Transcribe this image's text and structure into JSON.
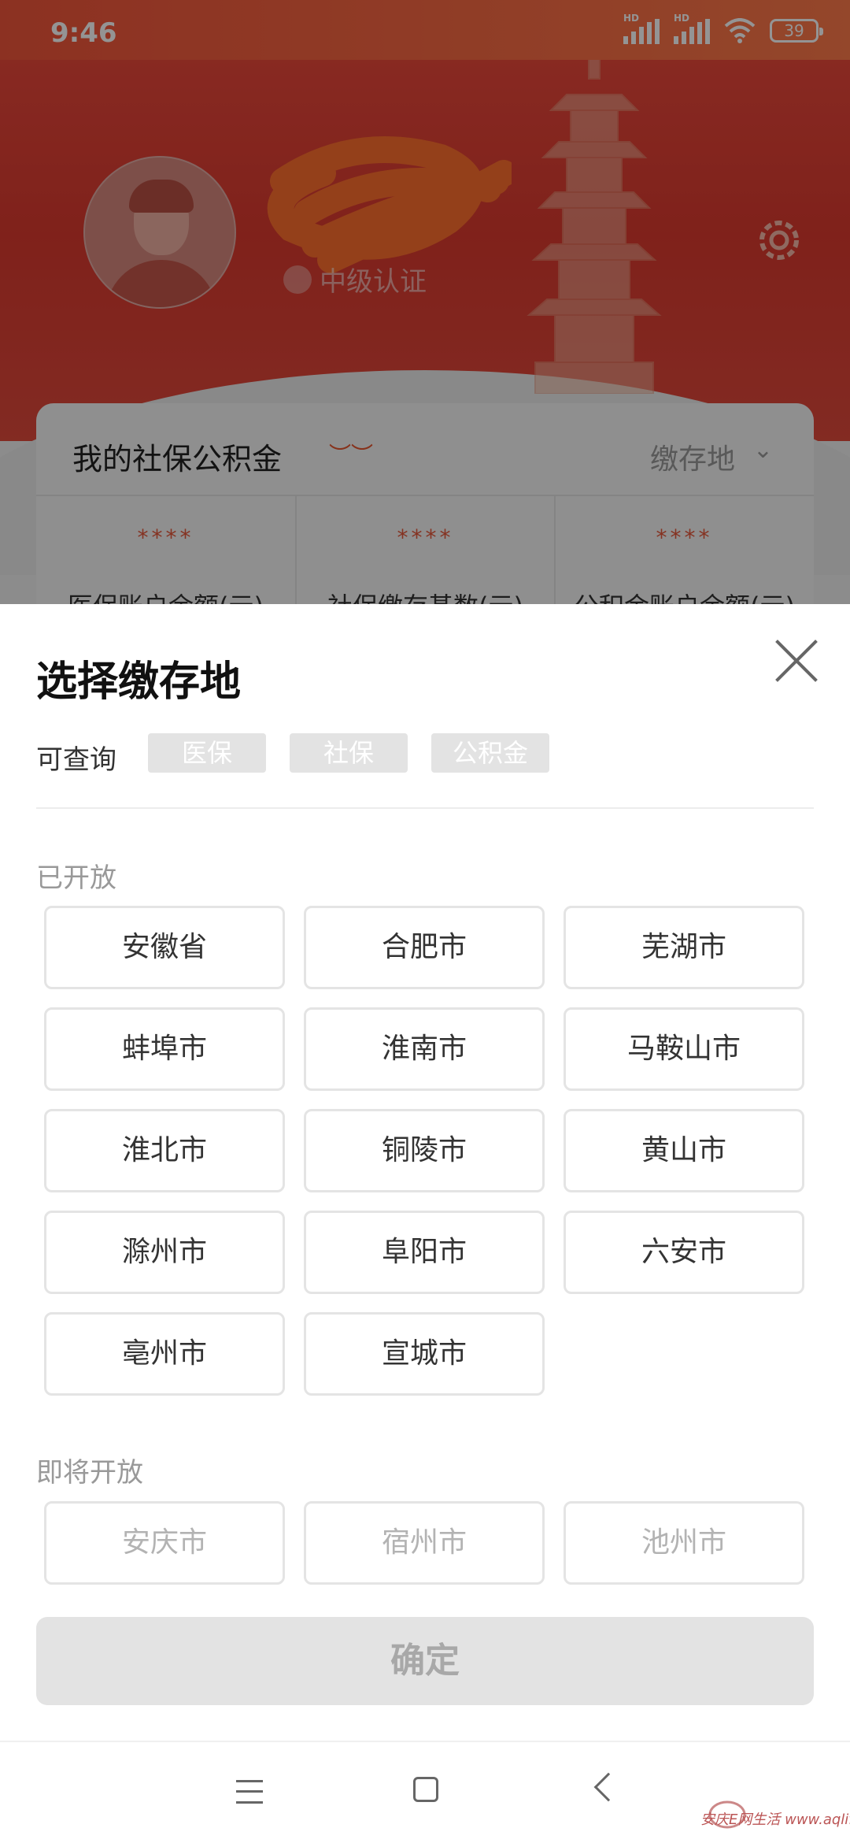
{
  "status_bar": {
    "time": "9:46",
    "battery": "39",
    "hd1": "HD",
    "hd2": "HD"
  },
  "profile": {
    "auth_label": "中级认证",
    "card_title": "我的社保公积金",
    "location_label": "缴存地",
    "stats": [
      {
        "value": "****",
        "label": "医保账户余额(元)"
      },
      {
        "value": "****",
        "label": "社保缴存基数(元)"
      },
      {
        "value": "****",
        "label": "公积金账户余额(元)"
      }
    ]
  },
  "sheet": {
    "title": "选择缴存地",
    "query_label": "可查询",
    "tags": [
      "医保",
      "社保",
      "公积金"
    ],
    "open_section": "已开放",
    "open_cities": [
      "安徽省",
      "合肥市",
      "芜湖市",
      "蚌埠市",
      "淮南市",
      "马鞍山市",
      "淮北市",
      "铜陵市",
      "黄山市",
      "滁州市",
      "阜阳市",
      "六安市",
      "亳州市",
      "宣城市"
    ],
    "soon_section": "即将开放",
    "soon_cities": [
      "安庆市",
      "宿州市",
      "池州市"
    ],
    "confirm_label": "确定"
  },
  "watermark": "安庆E网生活 www.aqlife.com",
  "colors": {
    "brand_red": "#e9473a",
    "status_orange": "#ff7a4a",
    "tag_gray": "#e3e3e3"
  }
}
